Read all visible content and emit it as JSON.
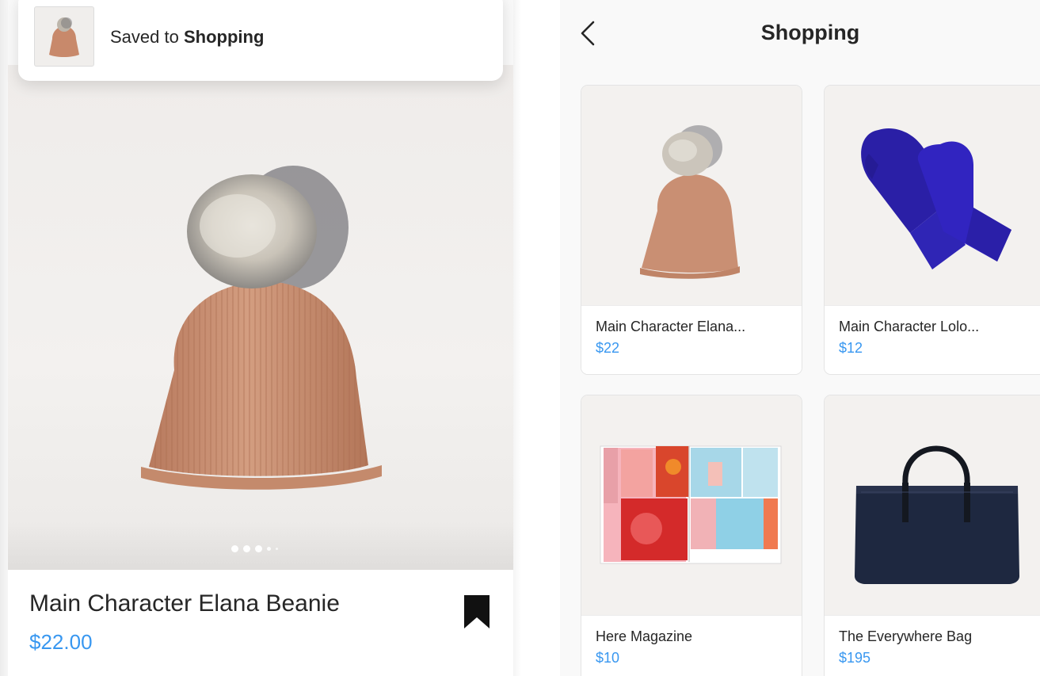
{
  "toast": {
    "prefix": "Saved to",
    "collection": "Shopping"
  },
  "left_header": {
    "more_glyph": "···"
  },
  "product": {
    "title": "Main Character Elana Beanie",
    "price": "$22.00",
    "image_icon": "beanie-photo",
    "carousel_count": 5,
    "carousel_current": 1
  },
  "collection_page": {
    "title": "Shopping",
    "back_icon": "chevron-left-icon",
    "items": [
      {
        "name": "Main Character Elana...",
        "price": "$22",
        "image": "beanie-photo"
      },
      {
        "name": "Main Character Lolo...",
        "price": "$12",
        "image": "mittens-photo"
      },
      {
        "name": "Here Magazine",
        "price": "$10",
        "image": "magazine-photo"
      },
      {
        "name": "The Everywhere Bag",
        "price": "$195",
        "image": "bag-photo"
      }
    ]
  },
  "colors": {
    "price_blue": "#3897f0",
    "text": "#262626",
    "beanie": "#c98f73",
    "mitten": "#2d22b0",
    "bag": "#1e2840"
  }
}
